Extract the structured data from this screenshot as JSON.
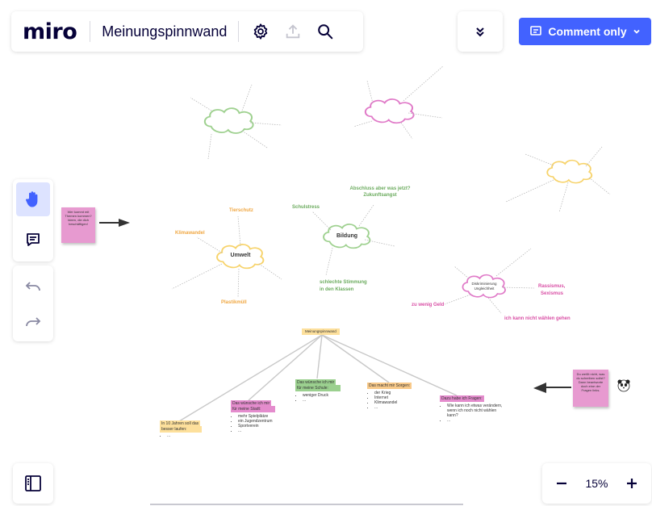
{
  "app": {
    "logo": "miro",
    "board_title": "Meinungspinnwand"
  },
  "toolbar_top": {
    "settings_icon": "gear-icon",
    "export_icon": "upload-icon",
    "search_icon": "search-icon"
  },
  "right_bar": {
    "collapse_icon": "double-chevron-down-icon",
    "comment_label": "Comment only",
    "accent": "#4262ff"
  },
  "zoom": {
    "level": "15%",
    "minus": "−",
    "plus": "+"
  },
  "canvas": {
    "sticky_left": "Wer kommt mit Themen kommen?Ideen, die dich beschäftigen!",
    "sticky_right": "Du weißt nicht, was du schreiben sollst? Dann beantworte doch eine der Fragen links.",
    "center_label": "Meinungspinnwand",
    "umwelt": {
      "title": "Umwelt",
      "tierschutz": "Tierschutz",
      "klimawandel": "Klimawandel",
      "plastikmuell": "Plastikmüll"
    },
    "bildung": {
      "title": "Bildung",
      "schulstress": "Schulstress",
      "abschluss": "Abschluss aber was jetzt? Zukunftsangst",
      "stimmung_1": "schlechte Stimmung",
      "stimmung_2": "in den Klassen"
    },
    "diskriminierung": {
      "title_1": "Diskriminierung",
      "title_2": "Ungleichheit",
      "rassismus_1": "Rassismus,",
      "rassismus_2": "Sexismus",
      "geld": "zu wenig Geld",
      "waehlen": "ich kann nicht wählen gehen"
    },
    "branches": [
      {
        "header_1": "In 10 Jahren soll das",
        "header_2": "besser laufen:",
        "items": [
          "..."
        ]
      },
      {
        "header_1": "Das wünsche ich mir",
        "header_2": "für meine Stadt:",
        "items": [
          "mehr Spielplätze",
          "ein Jugendzentrum",
          "Sportverein",
          "..."
        ]
      },
      {
        "header_1": "Das wünsche ich mir",
        "header_2": "für meine Schule:",
        "items": [
          "weniger Druck",
          "..."
        ]
      },
      {
        "header_1": "Das macht mir Sorgen:",
        "header_2": "",
        "items": [
          "der Krieg",
          "Internet",
          "Klimawandel",
          "..."
        ]
      },
      {
        "header_1": "Dazu habe ich Fragen:",
        "header_2": "",
        "items": [
          "Wie kann ich etwas verändern, wenn ich noch nicht wählen kann?",
          "..."
        ]
      }
    ]
  }
}
